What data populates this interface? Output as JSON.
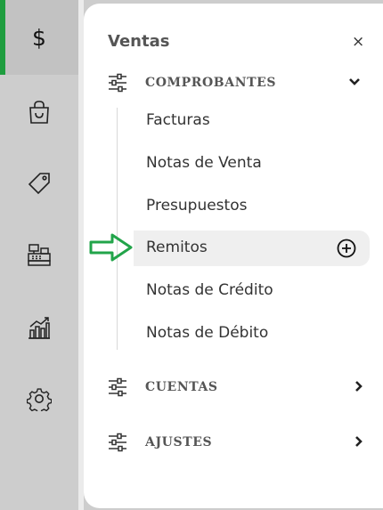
{
  "rail": {
    "active_icon": "$",
    "accent_color": "#1f9d3f",
    "items": [
      "dollar-icon",
      "shopping-bag-icon",
      "tag-icon",
      "cash-register-icon",
      "bar-chart-icon",
      "gear-icon"
    ]
  },
  "panel": {
    "title": "Ventas",
    "close_label": "×",
    "sections": [
      {
        "label": "COMPROBANTES",
        "expanded": true,
        "items": [
          "Facturas",
          "Notas de Venta",
          "Presupuestos",
          "Remitos",
          "Notas de Crédito",
          "Notas de Débito"
        ]
      },
      {
        "label": "CUENTAS",
        "expanded": false
      },
      {
        "label": "AJUSTES",
        "expanded": false
      }
    ]
  }
}
